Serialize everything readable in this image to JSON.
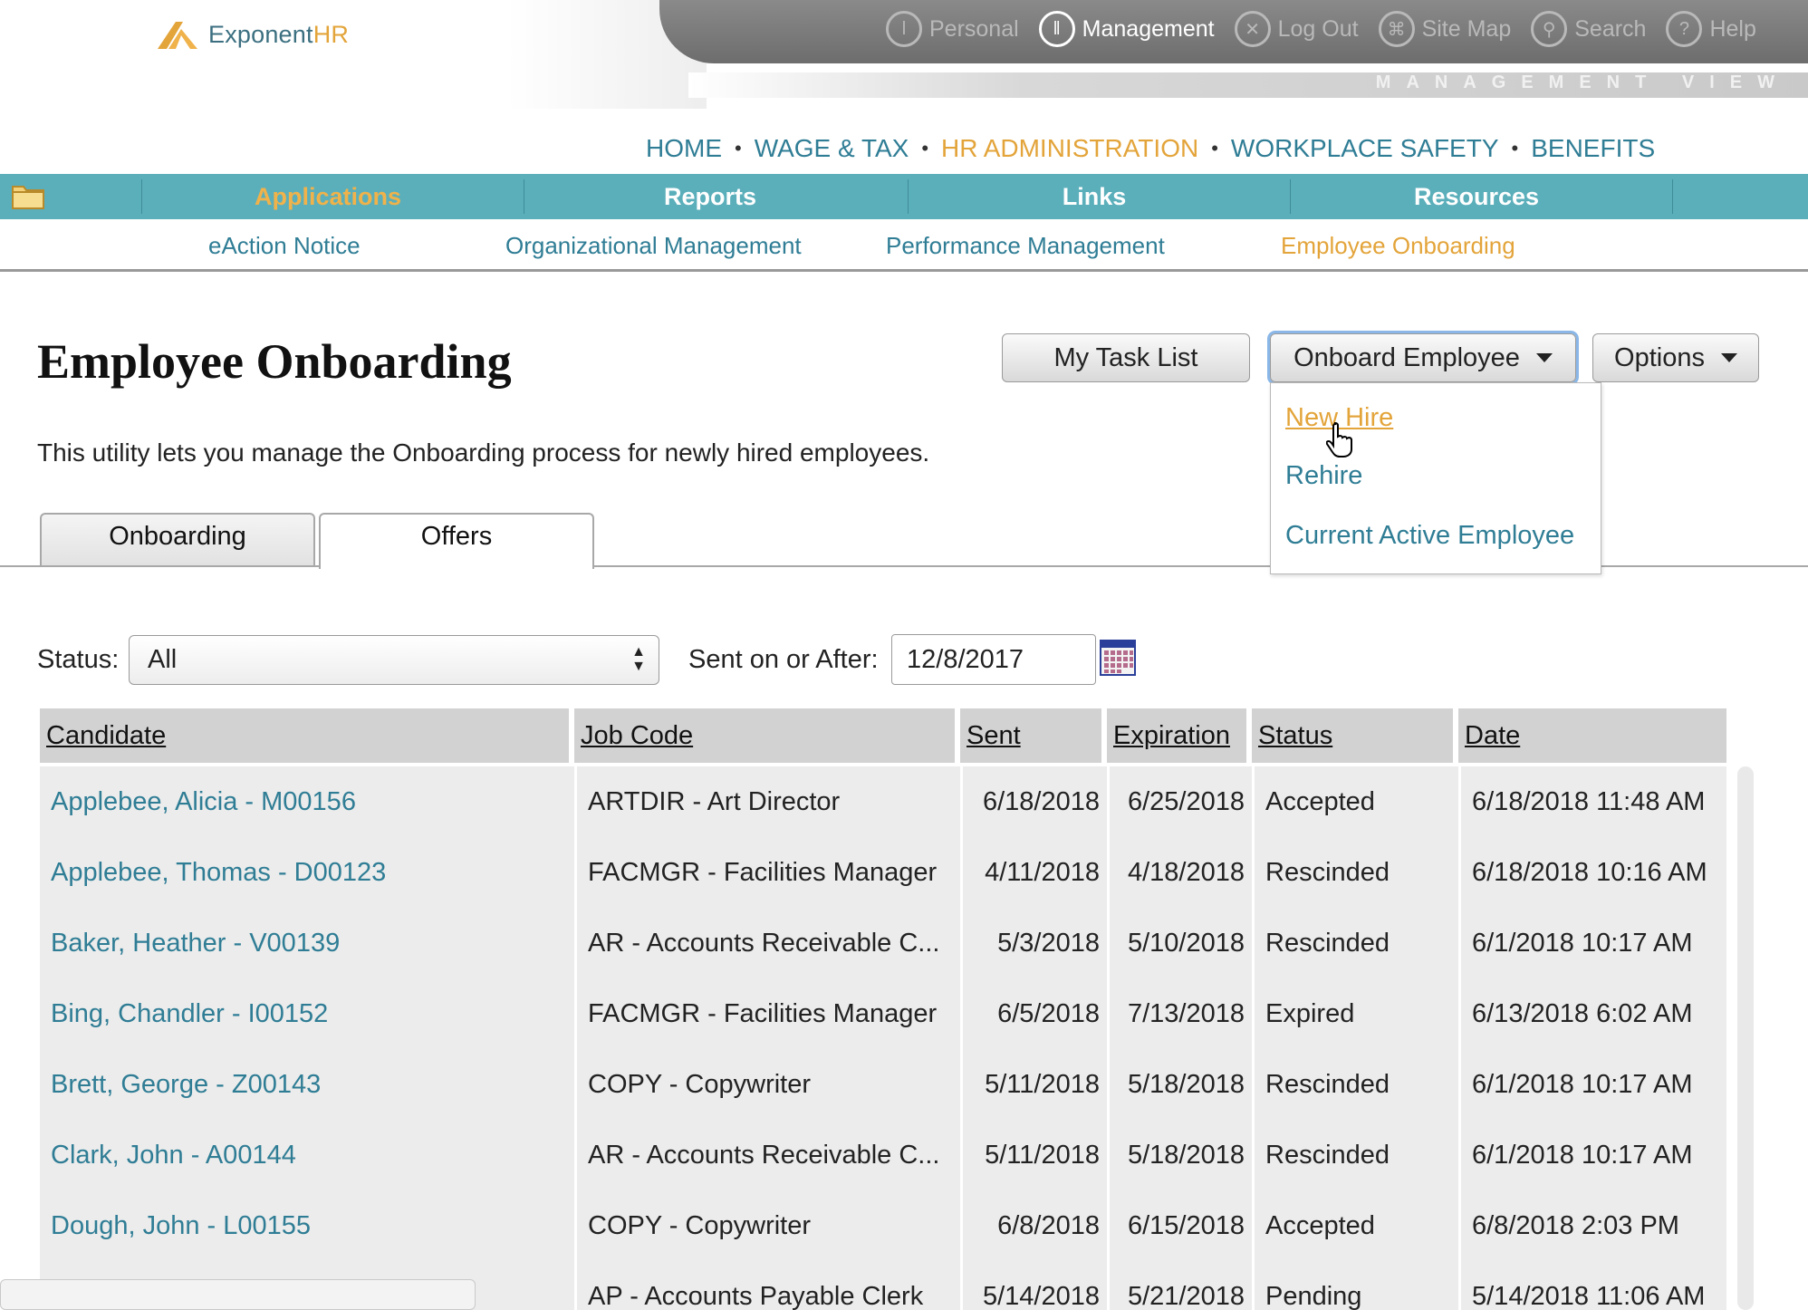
{
  "header": {
    "logo": {
      "brand": "Exponent",
      "brand_accent": "HR"
    },
    "utility_links": [
      {
        "label": "Personal",
        "icon": "person-icon",
        "active": false
      },
      {
        "label": "Management",
        "icon": "people-icon",
        "active": true
      },
      {
        "label": "Log Out",
        "icon": "logout-icon",
        "active": false
      },
      {
        "label": "Site Map",
        "icon": "sitemap-icon",
        "active": false
      },
      {
        "label": "Search",
        "icon": "search-icon",
        "active": false
      },
      {
        "label": "Help",
        "icon": "help-icon",
        "active": false
      }
    ],
    "view_label": "MANAGEMENT VIEW"
  },
  "main_nav": {
    "items": [
      "HOME",
      "WAGE & TAX",
      "HR ADMINISTRATION",
      "WORKPLACE SAFETY",
      "BENEFITS"
    ],
    "active": "HR ADMINISTRATION"
  },
  "section_tabs": {
    "items": [
      "Applications",
      "Reports",
      "Links",
      "Resources"
    ],
    "active": "Applications"
  },
  "sub_nav": {
    "items": [
      "eAction Notice",
      "Organizational Management",
      "Performance Management",
      "Employee Onboarding"
    ],
    "active": "Employee Onboarding"
  },
  "page": {
    "title": "Employee Onboarding",
    "description": "This utility lets you manage the Onboarding process for newly hired employees."
  },
  "toolbar": {
    "my_task_list": "My Task List",
    "onboard_employee": "Onboard Employee",
    "options": "Options"
  },
  "onboard_menu": {
    "items": [
      "New Hire",
      "Rehire",
      "Current Active Employee"
    ],
    "hovered": "New Hire"
  },
  "tabs": {
    "items": [
      "Onboarding",
      "Offers"
    ],
    "active": "Offers"
  },
  "filters": {
    "status_label": "Status:",
    "status_value": "All",
    "sent_label": "Sent on or After:",
    "sent_value": "12/8/2017"
  },
  "table": {
    "columns": [
      "Candidate",
      "Job Code",
      "Sent",
      "Expiration",
      "Status",
      "Date"
    ],
    "rows": [
      [
        "Applebee, Alicia - M00156",
        "ARTDIR - Art Director",
        "6/18/2018",
        "6/25/2018",
        "Accepted",
        "6/18/2018 11:48 AM"
      ],
      [
        "Applebee, Thomas - D00123",
        "FACMGR - Facilities Manager",
        "4/11/2018",
        "4/18/2018",
        "Rescinded",
        "6/18/2018 10:16 AM"
      ],
      [
        "Baker, Heather - V00139",
        "AR - Accounts Receivable C...",
        "5/3/2018",
        "5/10/2018",
        "Rescinded",
        "6/1/2018 10:17 AM"
      ],
      [
        "Bing, Chandler - I00152",
        "FACMGR - Facilities Manager",
        "6/5/2018",
        "7/13/2018",
        "Expired",
        "6/13/2018 6:02 AM"
      ],
      [
        "Brett, George - Z00143",
        "COPY - Copywriter",
        "5/11/2018",
        "5/18/2018",
        "Rescinded",
        "6/1/2018 10:17 AM"
      ],
      [
        "Clark, John - A00144",
        "AR - Accounts Receivable C...",
        "5/11/2018",
        "5/18/2018",
        "Rescinded",
        "6/1/2018 10:17 AM"
      ],
      [
        "Dough, John - L00155",
        "COPY - Copywriter",
        "6/8/2018",
        "6/15/2018",
        "Accepted",
        "6/8/2018 2:03 PM"
      ],
      [
        "",
        "AP - Accounts Payable Clerk",
        "5/14/2018",
        "5/21/2018",
        "Pending",
        "5/14/2018 11:06 AM"
      ]
    ]
  },
  "colors": {
    "teal": "#5bafbb",
    "link": "#2f7d95",
    "accent": "#e3a43a",
    "row_bg": "#ececec",
    "header_bg": "#d2d2d2"
  }
}
